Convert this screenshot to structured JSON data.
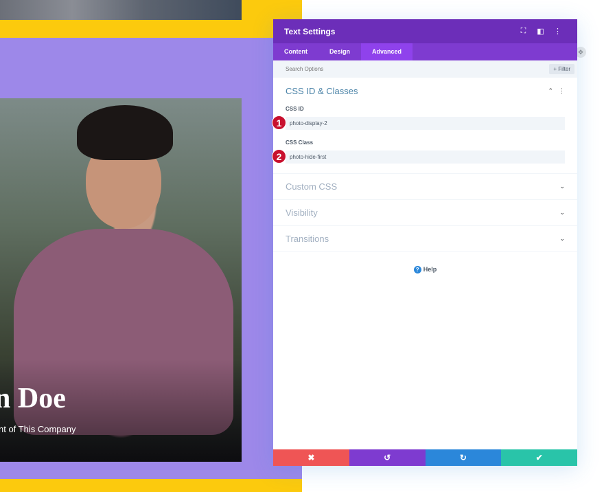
{
  "background": {
    "person_name": "n Doe",
    "person_title": "nt of This Company",
    "colors": {
      "yellow": "#fcca0d",
      "purple": "#9d88e9"
    }
  },
  "panel": {
    "title": "Text Settings",
    "header_icons": [
      "fullscreen-icon",
      "split-view-icon",
      "more-options-icon"
    ],
    "tabs": [
      {
        "label": "Content",
        "active": false
      },
      {
        "label": "Design",
        "active": false
      },
      {
        "label": "Advanced",
        "active": true
      }
    ],
    "search": {
      "placeholder": "Search Options",
      "filter_label": "+ Filter"
    },
    "open_section": {
      "title": "CSS ID & Classes",
      "fields": [
        {
          "label": "CSS ID",
          "value": "photo-display-2",
          "badge": "1"
        },
        {
          "label": "CSS Class",
          "value": "photo-hide-first",
          "badge": "2"
        }
      ]
    },
    "closed_sections": [
      {
        "title": "Custom CSS"
      },
      {
        "title": "Visibility"
      },
      {
        "title": "Transitions"
      }
    ],
    "help_label": "Help",
    "footer": {
      "cancel": "✖",
      "undo": "↺",
      "redo": "↻",
      "save": "✔"
    },
    "colors": {
      "header": "#6c2eb9",
      "tabs": "#7e3bd0",
      "active_tab": "#8f42ec",
      "cancel": "#ef5555",
      "undo": "#7e3bd0",
      "redo": "#2b87da",
      "save": "#29c4a9"
    }
  }
}
